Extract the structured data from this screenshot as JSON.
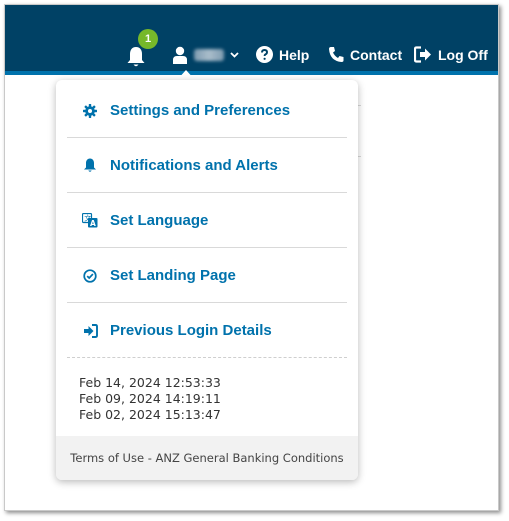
{
  "header": {
    "notification_count": "1",
    "help_label": "Help",
    "contact_label": "Contact",
    "logoff_label": "Log Off",
    "bar_color": "#004165",
    "accent_color": "#0072ac",
    "badge_color": "#76b82a"
  },
  "menu": {
    "items": [
      {
        "label": "Settings and Preferences",
        "icon": "gear-icon"
      },
      {
        "label": "Notifications and Alerts",
        "icon": "bell-icon"
      },
      {
        "label": "Set Language",
        "icon": "translate-icon"
      },
      {
        "label": "Set Landing Page",
        "icon": "check-circle-icon"
      },
      {
        "label": "Previous Login Details",
        "icon": "sign-in-icon"
      }
    ],
    "previous_logins": [
      "Feb 14, 2024 12:53:33",
      "Feb 09, 2024 14:19:11",
      "Feb 02, 2024 15:13:47"
    ],
    "footer_text": "Terms of Use - ANZ General Banking Conditions"
  }
}
